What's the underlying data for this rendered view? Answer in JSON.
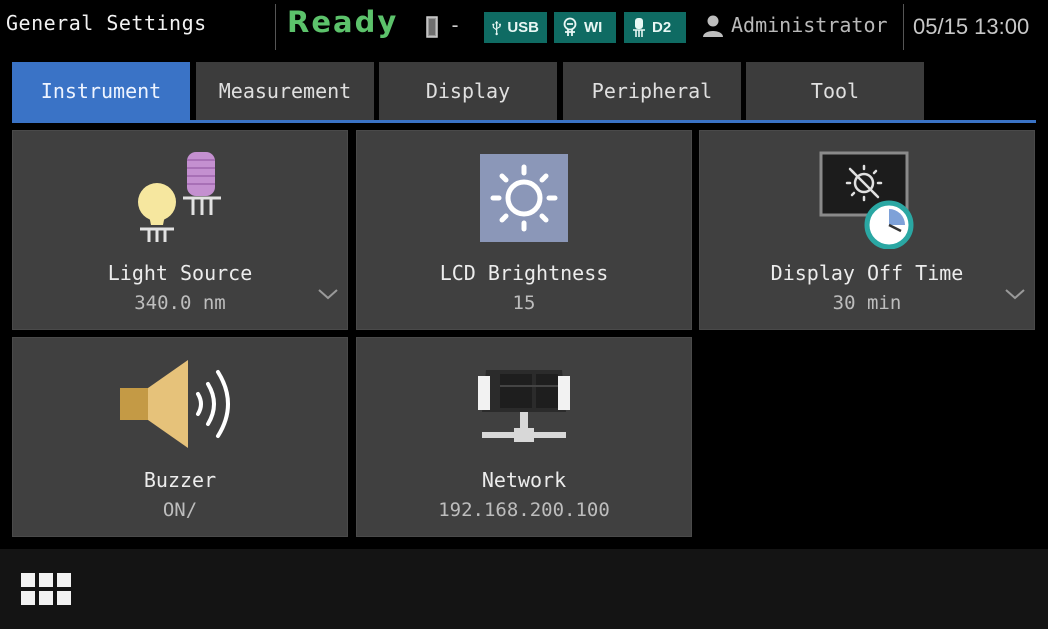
{
  "header": {
    "title": "General Settings",
    "status": "Ready",
    "lamp_state": "-",
    "connections": [
      {
        "icon": "usb-icon",
        "label": "USB"
      },
      {
        "icon": "lamp-icon",
        "label": "WI"
      },
      {
        "icon": "lamp-icon",
        "label": "D2"
      }
    ],
    "user": "Administrator",
    "datetime": "05/15 13:00"
  },
  "tabs": [
    "Instrument",
    "Measurement",
    "Display",
    "Peripheral",
    "Tool"
  ],
  "active_tab": "Instrument",
  "tiles": [
    {
      "icon": "light-source-icon",
      "label": "Light Source",
      "value": "340.0 nm",
      "has_dropdown": true
    },
    {
      "icon": "brightness-icon",
      "label": "LCD Brightness",
      "value": "15",
      "has_dropdown": false
    },
    {
      "icon": "display-off-timer-icon",
      "label": "Display Off Time",
      "value": "30 min",
      "has_dropdown": true
    },
    {
      "icon": "speaker-icon",
      "label": "Buzzer",
      "value": "ON/",
      "has_dropdown": false
    },
    {
      "icon": "network-icon",
      "label": "Network",
      "value": "192.168.200.100",
      "has_dropdown": false
    }
  ],
  "bottom_bar": {
    "apps_icon": "grid-icon"
  },
  "colors": {
    "accent": "#3a73c6",
    "ready": "#5cc26b",
    "badge": "#0f6b63",
    "tile": "#404040",
    "background": "#000000"
  }
}
